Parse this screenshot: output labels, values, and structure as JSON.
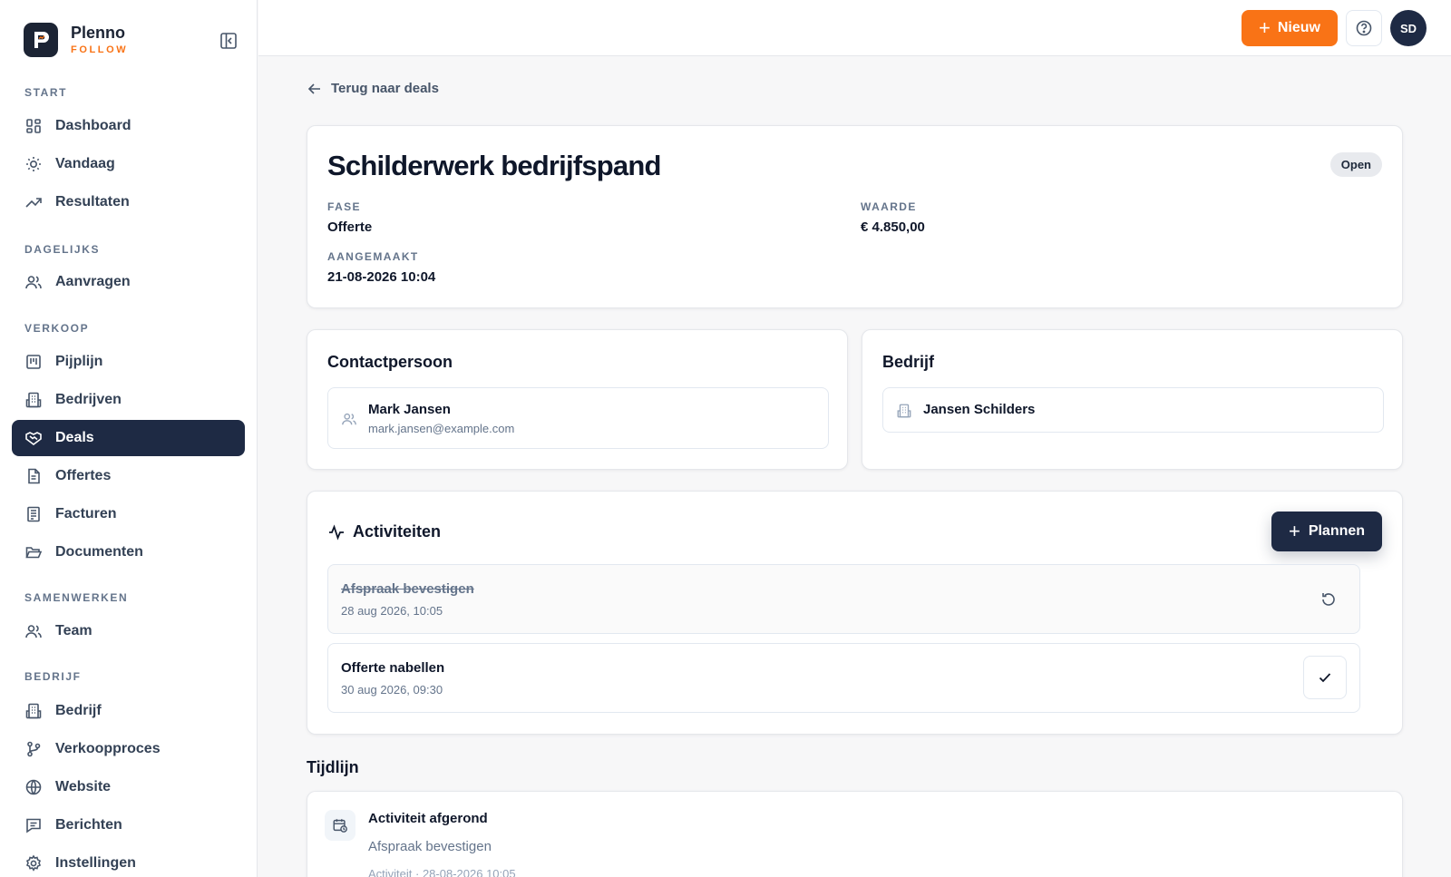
{
  "brand": {
    "name": "Plenno",
    "sub": "FOLLOW"
  },
  "sidebar": {
    "sections": [
      {
        "label": "START",
        "items": [
          {
            "label": "Dashboard",
            "icon": "dashboard-icon"
          },
          {
            "label": "Vandaag",
            "icon": "sun-icon"
          },
          {
            "label": "Resultaten",
            "icon": "trending-up-icon"
          }
        ]
      },
      {
        "label": "DAGELIJKS",
        "items": [
          {
            "label": "Aanvragen",
            "icon": "users-icon"
          }
        ]
      },
      {
        "label": "VERKOOP",
        "items": [
          {
            "label": "Pijplijn",
            "icon": "kanban-icon"
          },
          {
            "label": "Bedrijven",
            "icon": "building-icon"
          },
          {
            "label": "Deals",
            "icon": "handshake-icon",
            "active": true
          },
          {
            "label": "Offertes",
            "icon": "file-text-icon"
          },
          {
            "label": "Facturen",
            "icon": "receipt-icon"
          },
          {
            "label": "Documenten",
            "icon": "folder-open-icon"
          }
        ]
      },
      {
        "label": "SAMENWERKEN",
        "items": [
          {
            "label": "Team",
            "icon": "users-icon"
          }
        ]
      },
      {
        "label": "BEDRIJF",
        "items": [
          {
            "label": "Bedrijf",
            "icon": "building-icon"
          },
          {
            "label": "Verkoopproces",
            "icon": "git-branch-icon"
          },
          {
            "label": "Website",
            "icon": "globe-icon"
          },
          {
            "label": "Berichten",
            "icon": "message-icon"
          },
          {
            "label": "Instellingen",
            "icon": "gear-icon"
          }
        ]
      }
    ]
  },
  "topbar": {
    "new_label": "Nieuw",
    "avatar_initials": "SD",
    "accent": "#f97316"
  },
  "back_label": "Terug naar deals",
  "deal": {
    "title": "Schilderwerk bedrijfspand",
    "status": "Open",
    "fase_label": "FASE",
    "fase": "Offerte",
    "waarde_label": "WAARDE",
    "waarde": "€ 4.850,00",
    "aangemaakt_label": "AANGEMAAKT",
    "aangemaakt": "21-08-2026 10:04"
  },
  "contact": {
    "heading": "Contactpersoon",
    "name": "Mark Jansen",
    "email": "mark.jansen@example.com"
  },
  "company": {
    "heading": "Bedrijf",
    "name": "Jansen Schilders"
  },
  "activities": {
    "heading": "Activiteiten",
    "plan_label": "Plannen",
    "items": [
      {
        "title": "Afspraak bevestigen",
        "date": "28 aug 2026, 10:05",
        "done": true
      },
      {
        "title": "Offerte nabellen",
        "date": "30 aug 2026, 09:30",
        "done": false
      }
    ]
  },
  "timeline": {
    "heading": "Tijdlijn",
    "items": [
      {
        "title": "Activiteit afgerond",
        "subtitle": "Afspraak bevestigen",
        "meta": "Activiteit · 28-08-2026 10:05"
      }
    ]
  }
}
